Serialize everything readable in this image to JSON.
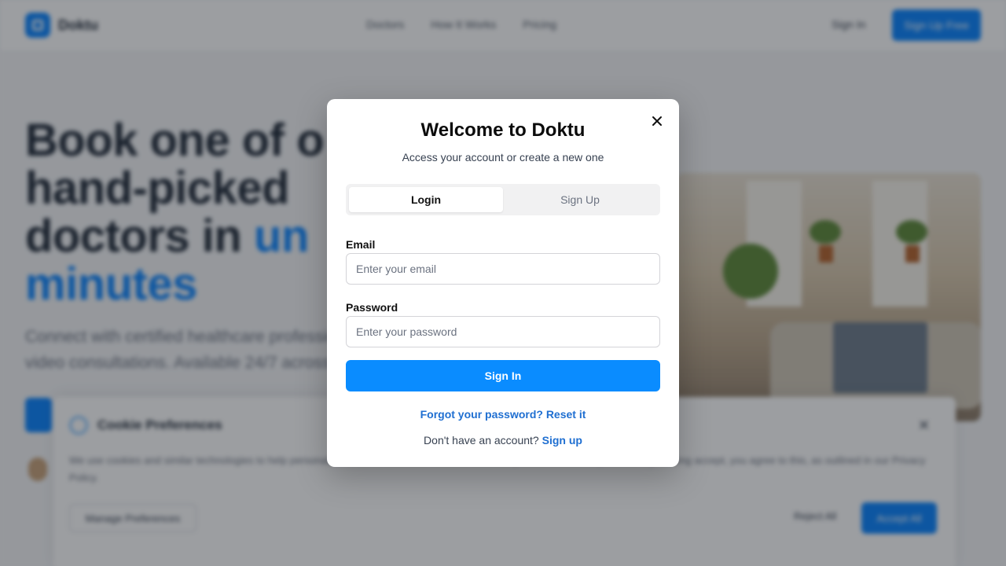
{
  "background": {
    "brand": "Doktu",
    "nav_links": [
      "Doctors",
      "How It Works",
      "Pricing"
    ],
    "nav_signin": "Sign In",
    "nav_signup": "Sign Up Free",
    "hero_line1": "Book one of o",
    "hero_line2": "hand-picked",
    "hero_line3": "doctors in ",
    "hero_line3_accent": "un",
    "hero_line4_accent": "minutes",
    "hero_sub_line1": "Connect with certified healthcare professio",
    "hero_sub_line2": "video consultations. Available 24/7 across Eu",
    "cookie_title": "Cookie Preferences",
    "cookie_text": "We use cookies and similar technologies to help personalise content, tailor and measure ads, and provide a better experience. By clicking accept, you agree to this, as outlined in our Privacy Policy.",
    "cookie_manage": "Manage Preferences",
    "cookie_reject": "Reject All",
    "cookie_accept": "Accept All"
  },
  "modal": {
    "title": "Welcome to Doktu",
    "subtitle": "Access your account or create a new one",
    "tabs": [
      {
        "label": "Login",
        "active": true
      },
      {
        "label": "Sign Up",
        "active": false
      }
    ],
    "email_label": "Email",
    "email_placeholder": "Enter your email",
    "email_value": "",
    "password_label": "Password",
    "password_placeholder": "Enter your password",
    "password_value": "",
    "submit_label": "Sign In",
    "forgot_text": "Forgot your password? Reset it",
    "no_account_text": "Don't have an account? ",
    "signup_link": "Sign up"
  },
  "colors": {
    "primary": "#0a8cff",
    "link": "#1f6fd1",
    "overlay": "rgba(20,24,32,0.42)"
  },
  "icons": {
    "close": "close-icon",
    "logo": "logo-icon",
    "cookie": "cookie-icon"
  }
}
